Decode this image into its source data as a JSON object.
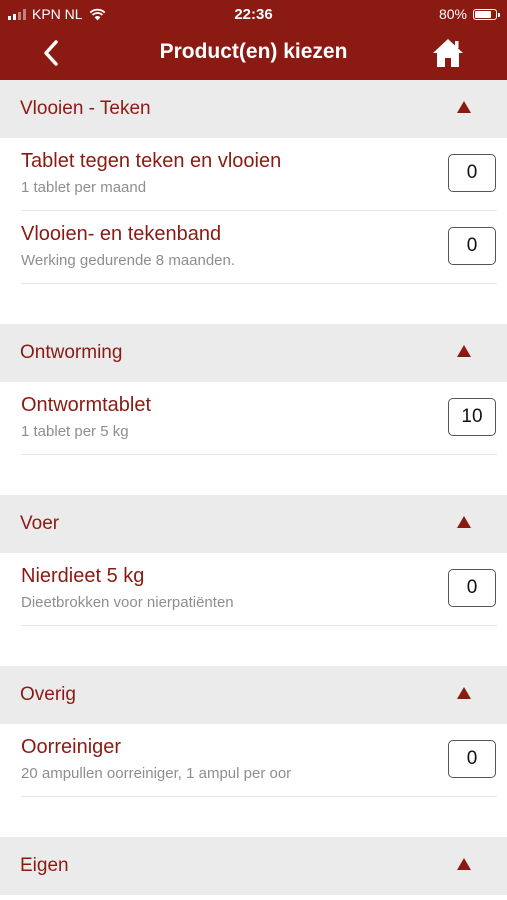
{
  "status_bar": {
    "carrier": "KPN NL",
    "time": "22:36",
    "battery": "80%",
    "battery_level": 0.8
  },
  "nav": {
    "title": "Product(en) kiezen"
  },
  "sections": [
    {
      "title": "Vlooien - Teken",
      "items": [
        {
          "name": "Tablet tegen teken en vlooien",
          "desc": "1 tablet per maand",
          "qty": "0"
        },
        {
          "name": "Vlooien- en tekenband",
          "desc": "Werking gedurende 8 maanden.",
          "qty": "0"
        }
      ]
    },
    {
      "title": "Ontworming",
      "items": [
        {
          "name": "Ontwormtablet",
          "desc": "1 tablet per 5 kg",
          "qty": "10"
        }
      ]
    },
    {
      "title": "Voer",
      "items": [
        {
          "name": "Nierdieet 5 kg",
          "desc": "Dieetbrokken voor nierpatiënten",
          "qty": "0"
        }
      ]
    },
    {
      "title": "Overig",
      "items": [
        {
          "name": "Oorreiniger",
          "desc": "20 ampullen oorreiniger, 1 ampul per oor",
          "qty": "0"
        }
      ]
    },
    {
      "title": "Eigen",
      "items": []
    }
  ],
  "icons": {
    "back": "chevron-left-icon",
    "home": "home-icon",
    "collapse": "triangle-up-icon",
    "wifi": "wifi-icon",
    "signal": "signal-icon",
    "battery": "battery-icon"
  },
  "colors": {
    "brand": "#8b1a13",
    "section_bg": "#ebebeb",
    "desc_text": "#8e8e8e"
  }
}
